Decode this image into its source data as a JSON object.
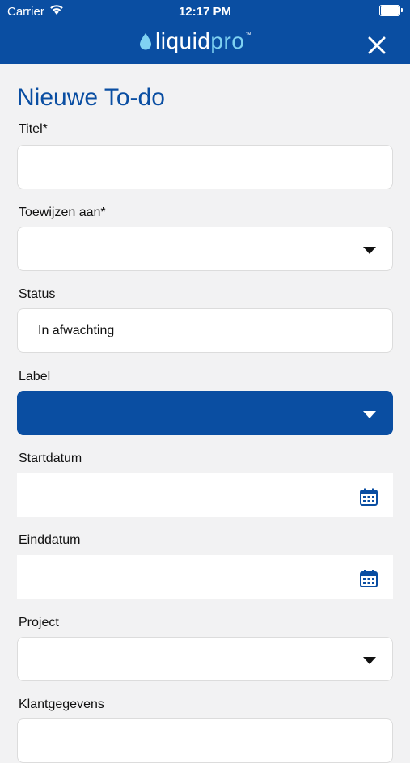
{
  "status_bar": {
    "carrier": "Carrier",
    "time": "12:17 PM"
  },
  "header": {
    "logo_part1": "liquid",
    "logo_part2": "pro",
    "logo_tm": "™",
    "colors": {
      "bar": "#0a4ea2",
      "accent": "#7fd2f2"
    }
  },
  "page": {
    "title": "Nieuwe To-do"
  },
  "form": {
    "titel": {
      "label": "Titel*",
      "value": ""
    },
    "toewijzen": {
      "label": "Toewijzen aan*",
      "value": ""
    },
    "status": {
      "label": "Status",
      "value": "In afwachting"
    },
    "label_field": {
      "label": "Label",
      "value": "",
      "color": "#0a4ea2"
    },
    "startdatum": {
      "label": "Startdatum",
      "value": ""
    },
    "einddatum": {
      "label": "Einddatum",
      "value": ""
    },
    "project": {
      "label": "Project",
      "value": ""
    },
    "klantgegevens": {
      "label": "Klantgegevens",
      "value": ""
    }
  },
  "icons": {
    "close": "close-icon",
    "caret": "chevron-down-icon",
    "calendar": "calendar-icon",
    "wifi": "wifi-icon",
    "battery": "battery-icon",
    "logo_drop": "drop-icon"
  }
}
